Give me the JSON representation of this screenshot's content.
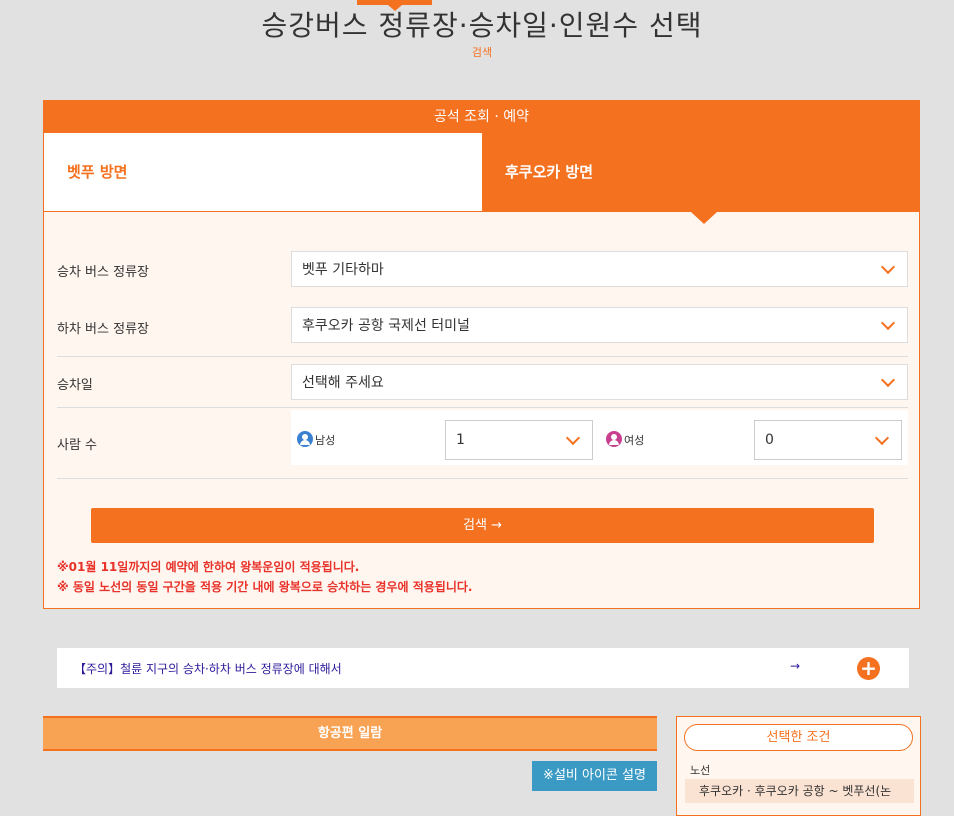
{
  "page": {
    "title": "승강버스 정류장·승차일·인원수 선택",
    "subtitle": "검색"
  },
  "panel": {
    "header": "공석 조회 · 예약",
    "tabs": [
      "벳푸 방면",
      "후쿠오카 방면"
    ],
    "active_tab": "후쿠오카 방면",
    "boarding_label": "승차 버스 정류장",
    "boarding_value": "벳푸 기타하마",
    "alighting_label": "하차 버스 정류장",
    "alighting_value": "후쿠오카 공항 국제선 터미널",
    "date_label": "승차일",
    "date_value": "선택해 주세요",
    "persons_label": "사람 수",
    "male_label": "남성",
    "male_value": "1",
    "female_label": "여성",
    "female_value": "0",
    "search_button": "검색 →",
    "notice1": "※01월 11일까지의 예약에 한하여 왕복운임이 적용됩니다.",
    "notice2": "※ 동일 노선의 동일 구간을 적용 기간 내에 왕복으로 승차하는 경우에 적용됩니다."
  },
  "caution": {
    "text": "【주의】철륜 지구의 승차·하차 버스 정류장에 대해서",
    "arrow": "→",
    "plus": "+"
  },
  "flights": {
    "header": "항공편 일람",
    "amenity_button": "※설비 아이콘 설명"
  },
  "conditions": {
    "title": "선택한 조건",
    "route_label": "노선",
    "route_value": "후쿠오카 · 후쿠오카 공항 ~ 벳푸선(논"
  },
  "colors": {
    "accent": "#f47120",
    "male_icon": "#3a80d0",
    "female_icon": "#c93f8f",
    "notice": "#e8322a",
    "link": "#2c1a9a",
    "amenity": "#3a9ac4"
  }
}
